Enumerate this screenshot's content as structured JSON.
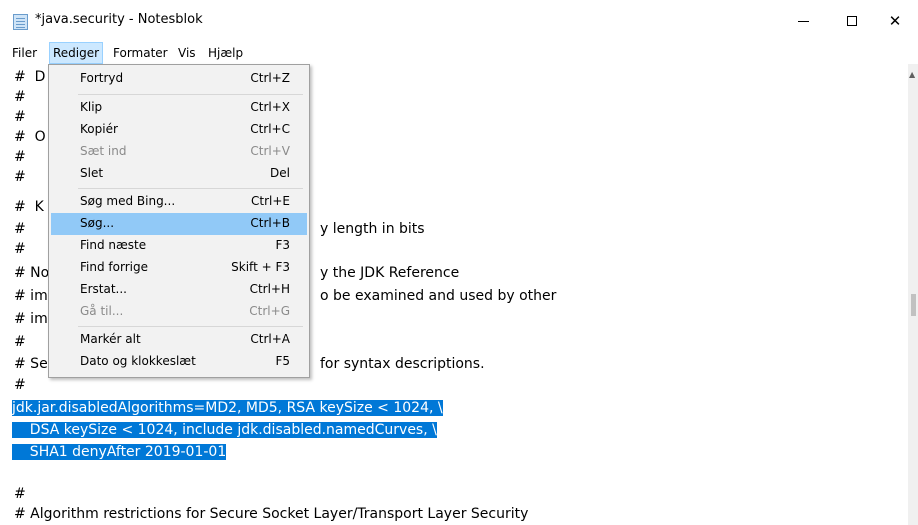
{
  "window": {
    "title": "*java.security - Notesblok"
  },
  "menubar": {
    "items": [
      "Filer",
      "Rediger",
      "Formater",
      "Vis",
      "Hjælp"
    ]
  },
  "editor": {
    "lines": [
      "#  D",
      "#",
      "#",
      "#  O",
      "#",
      "#",
      "#  K",
      "#",
      "#",
      "# No",
      "# im",
      "# im",
      "#",
      "# Se",
      "#",
      "jdk.jar.disabledAlgorithms=MD2, MD5, RSA keySize < 1024, \\",
      "    DSA keySize < 1024, include jdk.disabled.namedCurves, \\",
      "    SHA1 denyAfter 2019-01-01",
      "",
      "#",
      "# Algorithm restrictions for Secure Socket Layer/Transport Layer Security"
    ],
    "right_fragments": [
      {
        "line": 7,
        "text": "y length in bits"
      },
      {
        "line": 9,
        "text": "y the JDK Reference"
      },
      {
        "line": 10,
        "text": "o be examined and used by other"
      },
      {
        "line": 13,
        "text": "for syntax descriptions."
      }
    ]
  },
  "rediger_menu": [
    {
      "label": "Fortryd",
      "shortcut": "Ctrl+Z",
      "enabled": true
    },
    {
      "label": "Klip",
      "shortcut": "Ctrl+X",
      "enabled": true
    },
    {
      "label": "Kopiér",
      "shortcut": "Ctrl+C",
      "enabled": true
    },
    {
      "label": "Sæt ind",
      "shortcut": "Ctrl+V",
      "enabled": false
    },
    {
      "label": "Slet",
      "shortcut": "Del",
      "enabled": true
    },
    {
      "label": "Søg med Bing...",
      "shortcut": "Ctrl+E",
      "enabled": true
    },
    {
      "label": "Søg...",
      "shortcut": "Ctrl+B",
      "enabled": true,
      "highlighted": true
    },
    {
      "label": "Find næste",
      "shortcut": "F3",
      "enabled": true
    },
    {
      "label": "Find forrige",
      "shortcut": "Skift + F3",
      "enabled": true
    },
    {
      "label": "Erstat...",
      "shortcut": "Ctrl+H",
      "enabled": true
    },
    {
      "label": "Gå til...",
      "shortcut": "Ctrl+G",
      "enabled": false
    },
    {
      "label": "Markér alt",
      "shortcut": "Ctrl+A",
      "enabled": true
    },
    {
      "label": "Dato og klokkeslæt",
      "shortcut": "F5",
      "enabled": true
    }
  ],
  "colors": {
    "selection": "#0078d7",
    "menu_highlight": "#91c9f7",
    "active_menu": "#cce8ff"
  }
}
